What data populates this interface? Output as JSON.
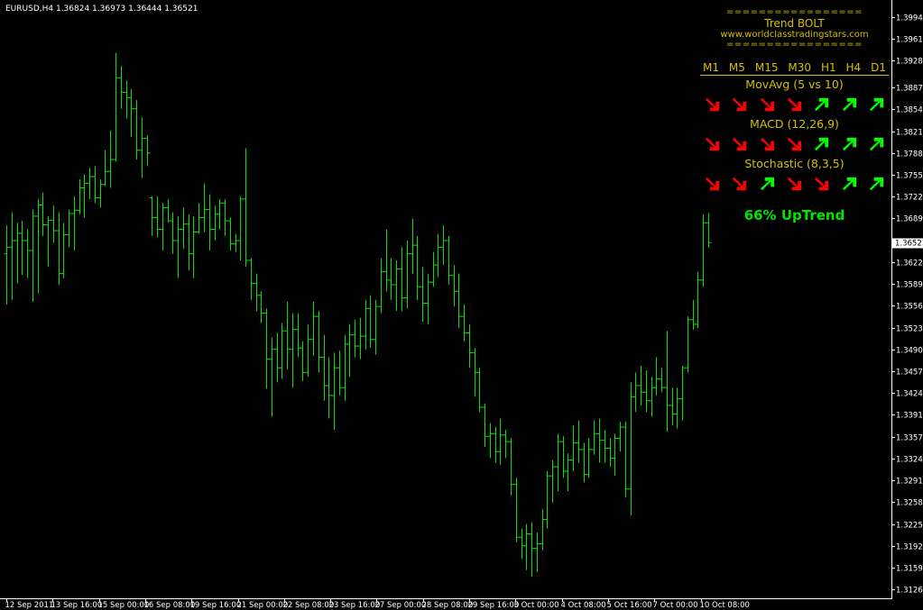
{
  "symbol_info": "EURUSD,H4  1.36824 1.36973 1.36444 1.36521",
  "panel": {
    "equals_line": "=================",
    "title": "Trend BOLT",
    "url": "www.worldclasstradingstars.com",
    "timeframes": [
      "M1",
      "M5",
      "M15",
      "M30",
      "H1",
      "H4",
      "D1"
    ],
    "indicators": [
      {
        "name": "MovAvg (5 vs 10)",
        "signals": [
          "down",
          "down",
          "down",
          "down",
          "up",
          "up",
          "up"
        ]
      },
      {
        "name": "MACD (12,26,9)",
        "signals": [
          "down",
          "down",
          "down",
          "down",
          "up",
          "up",
          "up"
        ]
      },
      {
        "name": "Stochastic (8,3,5)",
        "signals": [
          "down",
          "down",
          "up",
          "down",
          "down",
          "up",
          "up"
        ]
      }
    ],
    "summary": "66% UpTrend",
    "up_color": "#00ff00",
    "down_color": "#ff0000"
  },
  "chart_data": {
    "type": "ohlc",
    "symbol": "EURUSD",
    "timeframe": "H4",
    "ohlc_current": {
      "open": 1.36824,
      "high": 1.36973,
      "low": 1.36444,
      "close": 1.36521
    },
    "bar_color": "#00e400",
    "ylim": [
      1.3112,
      1.4
    ],
    "y_ticks": [
      "1.39940",
      "1.39610",
      "1.39280",
      "1.38870",
      "1.38540",
      "1.38210",
      "1.37880",
      "1.37550",
      "1.37220",
      "1.36890",
      "1.36521",
      "1.36220",
      "1.35890",
      "1.35560",
      "1.35230",
      "1.34900",
      "1.34570",
      "1.34240",
      "1.33910",
      "1.33570",
      "1.33240",
      "1.32910",
      "1.32580",
      "1.32250",
      "1.31920",
      "1.31590",
      "1.31260"
    ],
    "current_price": "1.36521",
    "x_ticks": [
      "12 Sep 2011",
      "13 Sep 16:00",
      "15 Sep 00:00",
      "16 Sep 08:00",
      "19 Sep 16:00",
      "21 Sep 00:00",
      "22 Sep 08:00",
      "23 Sep 16:00",
      "27 Sep 00:00",
      "28 Sep 08:00",
      "29 Sep 16:00",
      "3 Oct 00:00",
      "4 Oct 08:00",
      "5 Oct 16:00",
      "7 Oct 00:00",
      "10 Oct 08:00"
    ],
    "bars": [
      {
        "o": 1.3635,
        "h": 1.3678,
        "l": 1.3558,
        "c": 1.3645
      },
      {
        "o": 1.3645,
        "h": 1.3698,
        "l": 1.3565,
        "c": 1.3655
      },
      {
        "o": 1.3655,
        "h": 1.3682,
        "l": 1.359,
        "c": 1.3666
      },
      {
        "o": 1.3666,
        "h": 1.3685,
        "l": 1.3603,
        "c": 1.3655
      },
      {
        "o": 1.3655,
        "h": 1.3672,
        "l": 1.3598,
        "c": 1.364
      },
      {
        "o": 1.364,
        "h": 1.3702,
        "l": 1.3562,
        "c": 1.3692
      },
      {
        "o": 1.3692,
        "h": 1.3718,
        "l": 1.3575,
        "c": 1.3709
      },
      {
        "o": 1.3709,
        "h": 1.3728,
        "l": 1.3662,
        "c": 1.3679
      },
      {
        "o": 1.3679,
        "h": 1.3692,
        "l": 1.3615,
        "c": 1.3686
      },
      {
        "o": 1.3686,
        "h": 1.3708,
        "l": 1.3652,
        "c": 1.367
      },
      {
        "o": 1.367,
        "h": 1.3698,
        "l": 1.3588,
        "c": 1.3605
      },
      {
        "o": 1.3605,
        "h": 1.3682,
        "l": 1.3598,
        "c": 1.3664
      },
      {
        "o": 1.3664,
        "h": 1.3702,
        "l": 1.3645,
        "c": 1.3696
      },
      {
        "o": 1.3696,
        "h": 1.3722,
        "l": 1.364,
        "c": 1.3701
      },
      {
        "o": 1.3701,
        "h": 1.3748,
        "l": 1.3695,
        "c": 1.3735
      },
      {
        "o": 1.3735,
        "h": 1.3755,
        "l": 1.369,
        "c": 1.3742
      },
      {
        "o": 1.3742,
        "h": 1.3765,
        "l": 1.3718,
        "c": 1.3752
      },
      {
        "o": 1.3752,
        "h": 1.3768,
        "l": 1.3712,
        "c": 1.372
      },
      {
        "o": 1.372,
        "h": 1.3748,
        "l": 1.3705,
        "c": 1.374
      },
      {
        "o": 1.374,
        "h": 1.3792,
        "l": 1.3738,
        "c": 1.376
      },
      {
        "o": 1.376,
        "h": 1.3822,
        "l": 1.3735,
        "c": 1.3778
      },
      {
        "o": 1.3778,
        "h": 1.394,
        "l": 1.3775,
        "c": 1.3902
      },
      {
        "o": 1.3902,
        "h": 1.392,
        "l": 1.3855,
        "c": 1.388
      },
      {
        "o": 1.388,
        "h": 1.3898,
        "l": 1.384,
        "c": 1.3872
      },
      {
        "o": 1.3872,
        "h": 1.3885,
        "l": 1.3812,
        "c": 1.3855
      },
      {
        "o": 1.3855,
        "h": 1.3868,
        "l": 1.3778,
        "c": 1.3792
      },
      {
        "o": 1.3792,
        "h": 1.3842,
        "l": 1.375,
        "c": 1.381
      },
      {
        "o": 1.381,
        "h": 1.3815,
        "l": 1.3768,
        "c": 1.3788
      },
      {
        "o": 1.372,
        "h": 1.3722,
        "l": 1.3662,
        "c": 1.369
      },
      {
        "o": 1.369,
        "h": 1.3722,
        "l": 1.366,
        "c": 1.3672
      },
      {
        "o": 1.3672,
        "h": 1.3712,
        "l": 1.364,
        "c": 1.3705
      },
      {
        "o": 1.3705,
        "h": 1.3718,
        "l": 1.3682,
        "c": 1.3685
      },
      {
        "o": 1.3685,
        "h": 1.3698,
        "l": 1.3635,
        "c": 1.3655
      },
      {
        "o": 1.3655,
        "h": 1.3692,
        "l": 1.3598,
        "c": 1.3672
      },
      {
        "o": 1.3672,
        "h": 1.3705,
        "l": 1.3642,
        "c": 1.368
      },
      {
        "o": 1.368,
        "h": 1.3695,
        "l": 1.361,
        "c": 1.3635
      },
      {
        "o": 1.3635,
        "h": 1.3692,
        "l": 1.3598,
        "c": 1.3668
      },
      {
        "o": 1.3668,
        "h": 1.3712,
        "l": 1.3665,
        "c": 1.369
      },
      {
        "o": 1.369,
        "h": 1.3742,
        "l": 1.3668,
        "c": 1.3702
      },
      {
        "o": 1.3702,
        "h": 1.3725,
        "l": 1.364,
        "c": 1.3672
      },
      {
        "o": 1.3672,
        "h": 1.3708,
        "l": 1.3655,
        "c": 1.3695
      },
      {
        "o": 1.3695,
        "h": 1.3718,
        "l": 1.3672,
        "c": 1.3712
      },
      {
        "o": 1.3712,
        "h": 1.3718,
        "l": 1.3662,
        "c": 1.3685
      },
      {
        "o": 1.3685,
        "h": 1.369,
        "l": 1.364,
        "c": 1.365
      },
      {
        "o": 1.365,
        "h": 1.3665,
        "l": 1.3638,
        "c": 1.3655
      },
      {
        "o": 1.3655,
        "h": 1.3722,
        "l": 1.3625,
        "c": 1.3718
      },
      {
        "o": 1.3718,
        "h": 1.3795,
        "l": 1.3615,
        "c": 1.3625
      },
      {
        "o": 1.3625,
        "h": 1.3628,
        "l": 1.3565,
        "c": 1.359
      },
      {
        "o": 1.359,
        "h": 1.3605,
        "l": 1.3548,
        "c": 1.3572
      },
      {
        "o": 1.3572,
        "h": 1.3578,
        "l": 1.353,
        "c": 1.3545
      },
      {
        "o": 1.3545,
        "h": 1.3552,
        "l": 1.343,
        "c": 1.3475
      },
      {
        "o": 1.3475,
        "h": 1.3508,
        "l": 1.3388,
        "c": 1.349
      },
      {
        "o": 1.349,
        "h": 1.3515,
        "l": 1.344,
        "c": 1.3462
      },
      {
        "o": 1.3462,
        "h": 1.353,
        "l": 1.3445,
        "c": 1.3518
      },
      {
        "o": 1.3518,
        "h": 1.3562,
        "l": 1.346,
        "c": 1.349
      },
      {
        "o": 1.349,
        "h": 1.3545,
        "l": 1.3432,
        "c": 1.352
      },
      {
        "o": 1.352,
        "h": 1.3545,
        "l": 1.3478,
        "c": 1.3492
      },
      {
        "o": 1.3492,
        "h": 1.3502,
        "l": 1.3442,
        "c": 1.3455
      },
      {
        "o": 1.3455,
        "h": 1.3528,
        "l": 1.3448,
        "c": 1.3505
      },
      {
        "o": 1.3505,
        "h": 1.3562,
        "l": 1.348,
        "c": 1.354
      },
      {
        "o": 1.354,
        "h": 1.3548,
        "l": 1.3455,
        "c": 1.3478
      },
      {
        "o": 1.3478,
        "h": 1.3512,
        "l": 1.3412,
        "c": 1.3435
      },
      {
        "o": 1.3435,
        "h": 1.3478,
        "l": 1.3385,
        "c": 1.342
      },
      {
        "o": 1.342,
        "h": 1.3485,
        "l": 1.3368,
        "c": 1.3462
      },
      {
        "o": 1.3462,
        "h": 1.3488,
        "l": 1.342,
        "c": 1.3432
      },
      {
        "o": 1.3432,
        "h": 1.3512,
        "l": 1.3412,
        "c": 1.3498
      },
      {
        "o": 1.3498,
        "h": 1.3528,
        "l": 1.3448,
        "c": 1.3512
      },
      {
        "o": 1.3512,
        "h": 1.3535,
        "l": 1.3478,
        "c": 1.3495
      },
      {
        "o": 1.3495,
        "h": 1.3538,
        "l": 1.3475,
        "c": 1.351
      },
      {
        "o": 1.351,
        "h": 1.3565,
        "l": 1.349,
        "c": 1.3552
      },
      {
        "o": 1.3552,
        "h": 1.3572,
        "l": 1.3492,
        "c": 1.3505
      },
      {
        "o": 1.3505,
        "h": 1.3565,
        "l": 1.3482,
        "c": 1.3555
      },
      {
        "o": 1.3555,
        "h": 1.3628,
        "l": 1.3545,
        "c": 1.3608
      },
      {
        "o": 1.3608,
        "h": 1.3672,
        "l": 1.3578,
        "c": 1.3595
      },
      {
        "o": 1.3595,
        "h": 1.3628,
        "l": 1.3565,
        "c": 1.3588
      },
      {
        "o": 1.3588,
        "h": 1.3625,
        "l": 1.3548,
        "c": 1.3612
      },
      {
        "o": 1.3612,
        "h": 1.3645,
        "l": 1.3548,
        "c": 1.3568
      },
      {
        "o": 1.3568,
        "h": 1.3655,
        "l": 1.3552,
        "c": 1.3635
      },
      {
        "o": 1.3635,
        "h": 1.3688,
        "l": 1.3605,
        "c": 1.3648
      },
      {
        "o": 1.3648,
        "h": 1.3662,
        "l": 1.3565,
        "c": 1.3585
      },
      {
        "o": 1.3585,
        "h": 1.3615,
        "l": 1.3532,
        "c": 1.356
      },
      {
        "o": 1.356,
        "h": 1.3605,
        "l": 1.3528,
        "c": 1.3592
      },
      {
        "o": 1.3592,
        "h": 1.3638,
        "l": 1.3585,
        "c": 1.3618
      },
      {
        "o": 1.3618,
        "h": 1.3665,
        "l": 1.36,
        "c": 1.3645
      },
      {
        "o": 1.3645,
        "h": 1.3678,
        "l": 1.3618,
        "c": 1.3655
      },
      {
        "o": 1.3655,
        "h": 1.3662,
        "l": 1.3588,
        "c": 1.3602
      },
      {
        "o": 1.3602,
        "h": 1.3618,
        "l": 1.3555,
        "c": 1.3578
      },
      {
        "o": 1.3578,
        "h": 1.3605,
        "l": 1.3522,
        "c": 1.354
      },
      {
        "o": 1.354,
        "h": 1.3558,
        "l": 1.3502,
        "c": 1.3515
      },
      {
        "o": 1.3515,
        "h": 1.3528,
        "l": 1.3462,
        "c": 1.3485
      },
      {
        "o": 1.3485,
        "h": 1.3492,
        "l": 1.3418,
        "c": 1.3455
      },
      {
        "o": 1.3455,
        "h": 1.3462,
        "l": 1.3395,
        "c": 1.3402
      },
      {
        "o": 1.3402,
        "h": 1.3408,
        "l": 1.3342,
        "c": 1.3358
      },
      {
        "o": 1.3358,
        "h": 1.3378,
        "l": 1.3325,
        "c": 1.3362
      },
      {
        "o": 1.3362,
        "h": 1.3372,
        "l": 1.3318,
        "c": 1.3335
      },
      {
        "o": 1.3335,
        "h": 1.3385,
        "l": 1.3315,
        "c": 1.336
      },
      {
        "o": 1.336,
        "h": 1.3368,
        "l": 1.3325,
        "c": 1.335
      },
      {
        "o": 1.335,
        "h": 1.3355,
        "l": 1.3268,
        "c": 1.3285
      },
      {
        "o": 1.3285,
        "h": 1.3295,
        "l": 1.3198,
        "c": 1.3205
      },
      {
        "o": 1.3205,
        "h": 1.3218,
        "l": 1.3172,
        "c": 1.3192
      },
      {
        "o": 1.3192,
        "h": 1.3225,
        "l": 1.3155,
        "c": 1.321
      },
      {
        "o": 1.321,
        "h": 1.3228,
        "l": 1.3145,
        "c": 1.3188
      },
      {
        "o": 1.3188,
        "h": 1.3212,
        "l": 1.3152,
        "c": 1.3195
      },
      {
        "o": 1.3195,
        "h": 1.3248,
        "l": 1.3185,
        "c": 1.3232
      },
      {
        "o": 1.3232,
        "h": 1.3305,
        "l": 1.3218,
        "c": 1.3298
      },
      {
        "o": 1.3298,
        "h": 1.3322,
        "l": 1.3258,
        "c": 1.3312
      },
      {
        "o": 1.3312,
        "h": 1.3362,
        "l": 1.3275,
        "c": 1.335
      },
      {
        "o": 1.335,
        "h": 1.3358,
        "l": 1.3295,
        "c": 1.3305
      },
      {
        "o": 1.3305,
        "h": 1.3332,
        "l": 1.3275,
        "c": 1.3322
      },
      {
        "o": 1.3322,
        "h": 1.3375,
        "l": 1.3305,
        "c": 1.3348
      },
      {
        "o": 1.3348,
        "h": 1.3382,
        "l": 1.3318,
        "c": 1.3338
      },
      {
        "o": 1.3338,
        "h": 1.3348,
        "l": 1.3288,
        "c": 1.33
      },
      {
        "o": 1.33,
        "h": 1.3355,
        "l": 1.3295,
        "c": 1.3338
      },
      {
        "o": 1.3338,
        "h": 1.3382,
        "l": 1.333,
        "c": 1.3362
      },
      {
        "o": 1.3362,
        "h": 1.3385,
        "l": 1.3318,
        "c": 1.3352
      },
      {
        "o": 1.3352,
        "h": 1.3368,
        "l": 1.3318,
        "c": 1.334
      },
      {
        "o": 1.334,
        "h": 1.3355,
        "l": 1.3312,
        "c": 1.3325
      },
      {
        "o": 1.3325,
        "h": 1.3362,
        "l": 1.3298,
        "c": 1.3355
      },
      {
        "o": 1.3355,
        "h": 1.338,
        "l": 1.3335,
        "c": 1.3372
      },
      {
        "o": 1.3372,
        "h": 1.338,
        "l": 1.3265,
        "c": 1.3278
      },
      {
        "o": 1.3278,
        "h": 1.344,
        "l": 1.3238,
        "c": 1.3418
      },
      {
        "o": 1.3418,
        "h": 1.3455,
        "l": 1.3395,
        "c": 1.3435
      },
      {
        "o": 1.3435,
        "h": 1.3465,
        "l": 1.3405,
        "c": 1.3425
      },
      {
        "o": 1.3425,
        "h": 1.3458,
        "l": 1.3395,
        "c": 1.3412
      },
      {
        "o": 1.3412,
        "h": 1.3448,
        "l": 1.3388,
        "c": 1.3432
      },
      {
        "o": 1.3432,
        "h": 1.3478,
        "l": 1.342,
        "c": 1.3445
      },
      {
        "o": 1.3445,
        "h": 1.3462,
        "l": 1.3425,
        "c": 1.3432
      },
      {
        "o": 1.3432,
        "h": 1.3518,
        "l": 1.3365,
        "c": 1.3405
      },
      {
        "o": 1.3405,
        "h": 1.3432,
        "l": 1.3375,
        "c": 1.3392
      },
      {
        "o": 1.3392,
        "h": 1.3432,
        "l": 1.337,
        "c": 1.3415
      },
      {
        "o": 1.3415,
        "h": 1.3465,
        "l": 1.3382,
        "c": 1.3462
      },
      {
        "o": 1.3462,
        "h": 1.354,
        "l": 1.3455,
        "c": 1.3535
      },
      {
        "o": 1.3535,
        "h": 1.3565,
        "l": 1.352,
        "c": 1.3528
      },
      {
        "o": 1.3528,
        "h": 1.3608,
        "l": 1.3522,
        "c": 1.3595
      },
      {
        "o": 1.3595,
        "h": 1.3695,
        "l": 1.3585,
        "c": 1.3682
      },
      {
        "o": 1.3682,
        "h": 1.3697,
        "l": 1.3644,
        "c": 1.3652
      }
    ]
  }
}
